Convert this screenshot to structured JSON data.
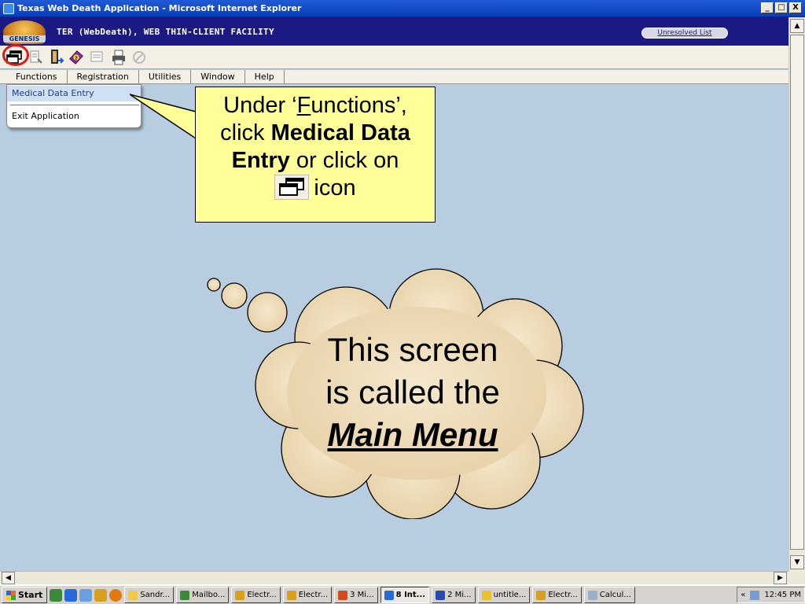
{
  "window": {
    "title": "Texas Web Death Application - Microsoft Internet Explorer",
    "minimize": "_",
    "maximize": "□",
    "close": "X"
  },
  "app": {
    "logo_text": "GENESIS",
    "title": "TER (WebDeath), WEB THIN-CLIENT FACILITY",
    "unresolved_list": "Unresolved List"
  },
  "toolbar": {
    "icons": [
      "windows-icon",
      "report-icon",
      "door-exit-icon",
      "help-book-icon",
      "document-icon",
      "printer-icon",
      "cancel-icon"
    ]
  },
  "menubar": {
    "items": [
      "Functions",
      "Registration",
      "Utilities",
      "Window",
      "Help"
    ]
  },
  "dropdown": {
    "items": [
      "Medical Data Entry",
      "Exit Application"
    ]
  },
  "callout": {
    "line1_prefix": "Under ‘",
    "line1_mnemonic": "F",
    "line1_rest": "unctions’,",
    "line2_prefix": "click ",
    "line2_bold": "Medical Data",
    "line3_bold": "Entry",
    "line3_rest": " or click on",
    "line4": "icon"
  },
  "cloud": {
    "line1": "This screen",
    "line2": "is called the",
    "line3": "Main Menu"
  },
  "taskbar": {
    "start": "Start",
    "tasks": [
      "Sandr...",
      "Mailbo...",
      "Electr...",
      "Electr...",
      "3 Mi...",
      "8 Int...",
      "2 Mi...",
      "untitle...",
      "Electr...",
      "Calcul..."
    ],
    "clock": "12:45 PM",
    "tray_chevron": "«"
  },
  "colors": {
    "background": "#b8cde0",
    "header_navy": "#1b1a84",
    "callout_yellow": "#ffff99",
    "highlight_circle": "#e01818",
    "cloud_fill": "#efdfbf"
  }
}
